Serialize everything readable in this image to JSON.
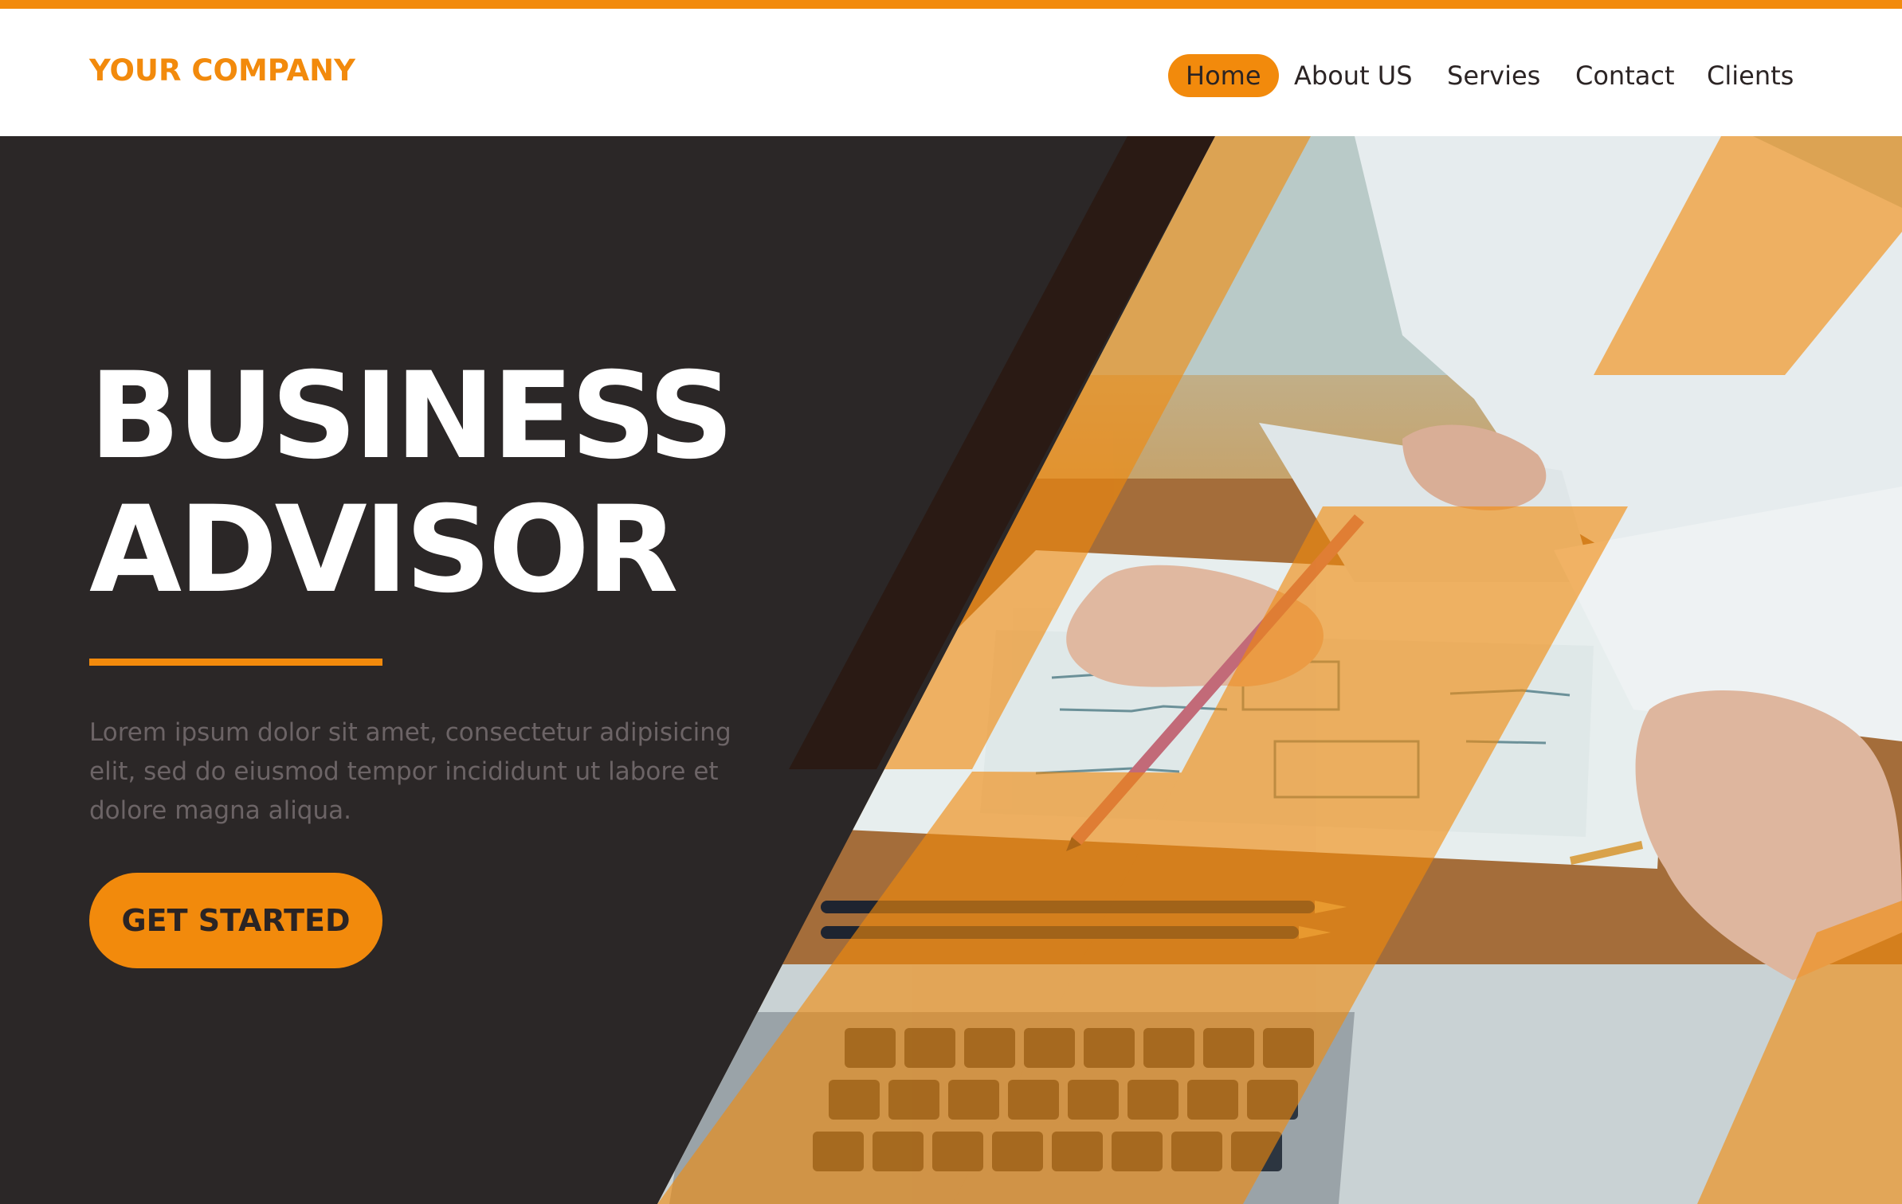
{
  "header": {
    "logo": "YOUR COMPANY",
    "nav": [
      {
        "label": "Home",
        "active": true
      },
      {
        "label": "About US",
        "active": false
      },
      {
        "label": "Servies",
        "active": false
      },
      {
        "label": "Contact",
        "active": false
      },
      {
        "label": "Clients",
        "active": false
      }
    ]
  },
  "hero": {
    "title_line1": "BUSINESS",
    "title_line2": "ADVISOR",
    "description": "Lorem ipsum dolor sit amet, consectetur adipisicing elit, sed do eiusmod tempor incididunt ut labore et dolore magna aliqua.",
    "cta_label": "GET STARTED",
    "image_subject": "business meeting photo - hands writing on paper documents with pencil, pens and laptop keyboard on desk"
  },
  "colors": {
    "accent": "#f28a0c",
    "dark_background": "#2b2727",
    "text_dark": "#2b2424",
    "muted_text": "#6c6466",
    "white": "#ffffff"
  }
}
